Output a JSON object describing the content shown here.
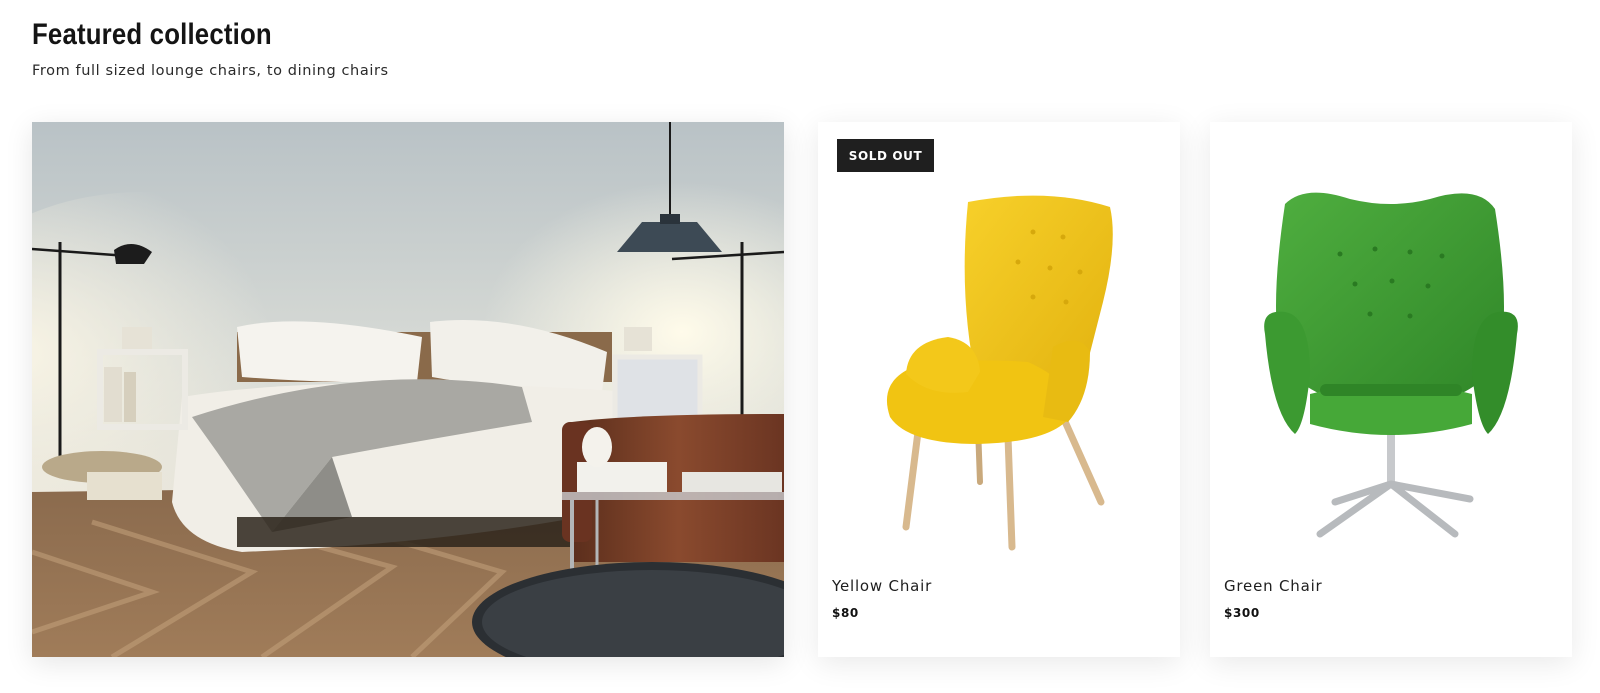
{
  "section": {
    "title": "Featured collection",
    "subtitle": "From full sized lounge chairs, to dining chairs"
  },
  "hero": {
    "icon": "bedroom-photo"
  },
  "products": [
    {
      "name": "Yellow Chair",
      "price": "$80",
      "badge": "SOLD OUT",
      "color": "#f4c619",
      "icon": "yellow-armchair"
    },
    {
      "name": "Green Chair",
      "price": "$300",
      "badge": "",
      "color": "#3f9a35",
      "icon": "green-egg-chair"
    }
  ],
  "colors": {
    "badge_bg": "#1f1f1f",
    "text": "#1a1a1a"
  }
}
